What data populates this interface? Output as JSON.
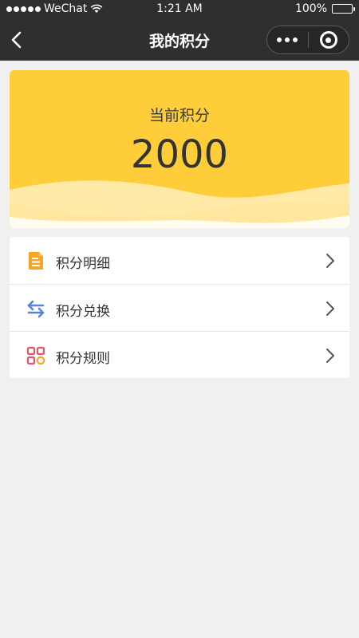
{
  "status_bar": {
    "carrier": "WeChat",
    "time": "1:21 AM",
    "battery": "100%"
  },
  "nav": {
    "title": "我的积分"
  },
  "points_card": {
    "label": "当前积分",
    "value": "2000",
    "color": "#ffcd3a"
  },
  "menu": {
    "items": [
      {
        "label": "积分明细",
        "icon": "document-icon",
        "icon_color": "#f5a623"
      },
      {
        "label": "积分兑换",
        "icon": "exchange-arrows-icon",
        "icon_color": "#5b84d6"
      },
      {
        "label": "积分规则",
        "icon": "grid-icon",
        "icon_color": "#e0566b"
      }
    ]
  }
}
